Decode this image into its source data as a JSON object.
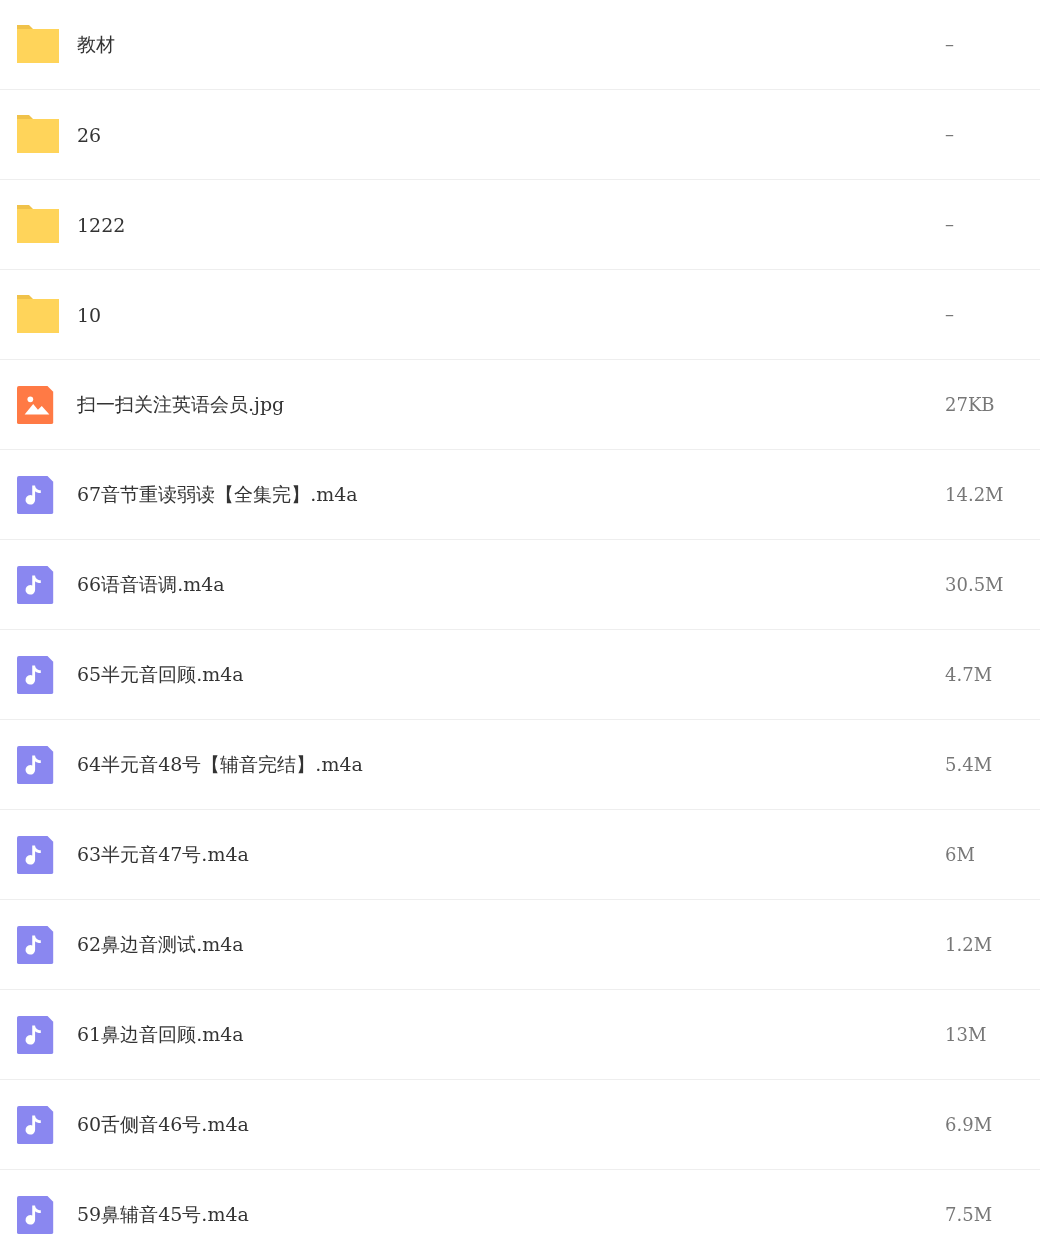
{
  "files": [
    {
      "kind": "folder",
      "name": "教材",
      "size": "–"
    },
    {
      "kind": "folder",
      "name": "26",
      "size": "–"
    },
    {
      "kind": "folder",
      "name": "1222",
      "size": "–"
    },
    {
      "kind": "folder",
      "name": "10",
      "size": "–"
    },
    {
      "kind": "image",
      "name": "扫一扫关注英语会员.jpg",
      "size": "27KB"
    },
    {
      "kind": "audio",
      "name": "67音节重读弱读【全集完】.m4a",
      "size": "14.2M"
    },
    {
      "kind": "audio",
      "name": "66语音语调.m4a",
      "size": "30.5M"
    },
    {
      "kind": "audio",
      "name": "65半元音回顾.m4a",
      "size": "4.7M"
    },
    {
      "kind": "audio",
      "name": "64半元音48号【辅音完结】.m4a",
      "size": "5.4M"
    },
    {
      "kind": "audio",
      "name": "63半元音47号.m4a",
      "size": "6M"
    },
    {
      "kind": "audio",
      "name": "62鼻边音测试.m4a",
      "size": "1.2M"
    },
    {
      "kind": "audio",
      "name": "61鼻边音回顾.m4a",
      "size": "13M"
    },
    {
      "kind": "audio",
      "name": "60舌侧音46号.m4a",
      "size": "6.9M"
    },
    {
      "kind": "audio",
      "name": "59鼻辅音45号.m4a",
      "size": "7.5M"
    }
  ]
}
